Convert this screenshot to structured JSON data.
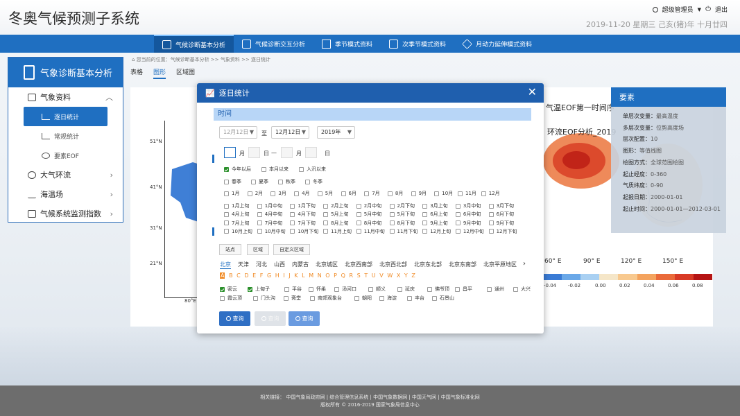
{
  "header": {
    "app_title": "冬奥气候预测子系统",
    "user": "超级管理员",
    "logout": "退出",
    "date": "2019-11-20 星期三 己亥(猪)年 十月廿四"
  },
  "nav": [
    {
      "label": "气候诊断基本分析",
      "icon": "doc-icon",
      "active": true
    },
    {
      "label": "气候诊断交互分析",
      "icon": "edit-icon",
      "active": false
    },
    {
      "label": "季节模式资料",
      "icon": "folder-icon",
      "active": false
    },
    {
      "label": "次季节模式资料",
      "icon": "star-icon",
      "active": false
    },
    {
      "label": "月动力延伸模式资料",
      "icon": "layers-icon",
      "active": false
    }
  ],
  "sidebar": {
    "title": "气象诊断基本分析",
    "items": [
      {
        "label": "气象资料",
        "expanded": true
      },
      {
        "label": "逐日统计",
        "sub": true,
        "active": true
      },
      {
        "label": "常规统计",
        "sub": true
      },
      {
        "label": "要素EOF",
        "sub": true
      },
      {
        "label": "大气环流"
      },
      {
        "label": "海温场"
      },
      {
        "label": "气候系统监测指数"
      }
    ]
  },
  "breadcrumb": "您当前的位置：气候诊断基本分析 >> 气象资料 >> 逐日统计",
  "tabs": [
    "表格",
    "图形",
    "区域图"
  ],
  "chart_bg": {
    "latitudes": [
      "51°N",
      "41°N",
      "31°N",
      "21°N"
    ],
    "lon_label": "80°E",
    "right_title_1": "气温EOF第一时间序",
    "right_title_2": "环流EOF分析_2019",
    "right_lons": [
      "60° E",
      "90° E",
      "120° E",
      "150° E"
    ],
    "colorbar_ticks": [
      "-0.04",
      "-0.02",
      "0.00",
      "0.02",
      "0.04",
      "0.06",
      "0.08"
    ],
    "colorbar_colors": [
      "#3a7bd5",
      "#6aa8e8",
      "#a9d0f2",
      "#f5e6c8",
      "#f8c98f",
      "#f4a35e",
      "#ea6a3a",
      "#d83a26",
      "#b51414"
    ]
  },
  "elements": {
    "title": "要素",
    "rows": [
      {
        "k": "单层次变量：",
        "v": "最高温度"
      },
      {
        "k": "多层次变量：",
        "v": "位势高度场"
      },
      {
        "k": "层次配置：",
        "v": "10"
      },
      {
        "k": "图形：",
        "v": "等值线图"
      },
      {
        "k": "绘图方式：",
        "v": "全球范围绘图"
      },
      {
        "k": "起止经度：",
        "v": "0-360"
      },
      {
        "k": "气质纬度：",
        "v": "0-90"
      },
      {
        "k": "起报日期：",
        "v": "2000-01-01"
      },
      {
        "k": "起止时间：",
        "v": "2000-01-01—2012-03-01"
      }
    ]
  },
  "modal": {
    "title": "逐日统计",
    "section_time": "时间",
    "date_from": "12月12日",
    "to": "至",
    "date_to": "12月12日",
    "year": "2019年",
    "month_label": "月",
    "day_label": "日",
    "dash": "—",
    "row1": [
      {
        "label": "今年以后",
        "on": true
      },
      {
        "label": "本月以来",
        "on": false
      },
      {
        "label": "入汛以来",
        "on": false
      }
    ],
    "seasons": [
      "春季",
      "夏季",
      "秋季",
      "冬季"
    ],
    "months": [
      "1月",
      "2月",
      "3月",
      "4月",
      "5月",
      "6月",
      "7月",
      "8月",
      "9月",
      "10月",
      "11月",
      "12月"
    ],
    "dekads": [
      [
        "1月上旬",
        "1月中旬",
        "1月下旬",
        "2月上旬",
        "2月中旬",
        "2月下旬",
        "3月上旬",
        "3月中旬",
        "3月下旬"
      ],
      [
        "4月上旬",
        "4月中旬",
        "4月下旬",
        "5月上旬",
        "5月中旬",
        "5月下旬",
        "6月上旬",
        "6月中旬",
        "6月下旬"
      ],
      [
        "7月上旬",
        "7月中旬",
        "7月下旬",
        "8月上旬",
        "8月中旬",
        "8月下旬",
        "9月上旬",
        "9月中旬",
        "9月下旬"
      ],
      [
        "10月上旬",
        "10月中旬",
        "10月下旬",
        "11月上旬",
        "11月中旬",
        "11月下旬",
        "12月上旬",
        "12月中旬",
        "12月下旬"
      ]
    ],
    "area_tabs": [
      "站点",
      "区域",
      "自定义区域"
    ],
    "cities": [
      "北京",
      "天津",
      "河北",
      "山西",
      "内蒙古",
      "北京城区",
      "北京西南部",
      "北京西北部",
      "北京东北部",
      "北京东南部",
      "北京平原地区"
    ],
    "letters": [
      "A",
      "B",
      "C",
      "D",
      "E",
      "F",
      "G",
      "H",
      "I",
      "J",
      "K",
      "L",
      "M",
      "N",
      "O",
      "P",
      "Q",
      "R",
      "S",
      "T",
      "U",
      "V",
      "W",
      "X",
      "Y",
      "Z"
    ],
    "stations1": [
      {
        "l": "密云",
        "on": true
      },
      {
        "l": "上甸子",
        "on": true
      },
      {
        "l": "平谷",
        "on": false
      },
      {
        "l": "怀柔",
        "on": false
      },
      {
        "l": "汤河口",
        "on": false
      },
      {
        "l": "顺义",
        "on": false
      },
      {
        "l": "延庆",
        "on": false
      },
      {
        "l": "佛爷顶",
        "on": false
      },
      {
        "l": "昌平",
        "on": false
      },
      {
        "l": "通州",
        "on": false
      },
      {
        "l": "大兴",
        "on": false
      }
    ],
    "stations2": [
      {
        "l": "霞云顶",
        "on": false
      },
      {
        "l": "门头沟",
        "on": false
      },
      {
        "l": "斋堂",
        "on": false
      },
      {
        "l": "南郊观象台",
        "on": false
      },
      {
        "l": "朝阳",
        "on": false
      },
      {
        "l": "海淀",
        "on": false
      },
      {
        "l": "丰台",
        "on": false
      },
      {
        "l": "石景山",
        "on": false
      }
    ],
    "query": "查询"
  },
  "footer": {
    "links": "相关链接：  中国气象局政府网 | 综合管理信息系统 | 中国气象数据网 | 中国天气网 | 中国气象标准化网",
    "copyright": "版权所有 © 2016-2019 国家气象局信息中心"
  }
}
